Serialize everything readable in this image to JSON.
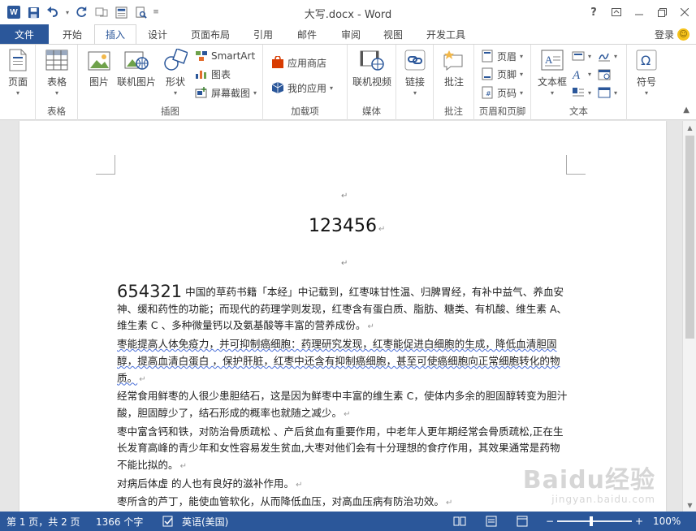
{
  "titlebar": {
    "doc_title": "大写.docx - Word",
    "help": "?",
    "app_logo": "W"
  },
  "tabs": {
    "file": "文件",
    "items": [
      "开始",
      "插入",
      "设计",
      "页面布局",
      "引用",
      "邮件",
      "审阅",
      "视图",
      "开发工具"
    ],
    "active": "插入",
    "login": "登录"
  },
  "ribbon": {
    "pages": {
      "btn": "页面",
      "group": ""
    },
    "table": {
      "btn": "表格",
      "group": "表格"
    },
    "illustrations": {
      "picture": "图片",
      "online_picture": "联机图片",
      "shapes": "形状",
      "smartart": "SmartArt",
      "chart": "图表",
      "screenshot": "屏幕截图",
      "group": "插图"
    },
    "addins": {
      "store": "应用商店",
      "my_apps": "我的应用",
      "group": "加载项"
    },
    "media": {
      "online_video": "联机视频",
      "group": "媒体"
    },
    "links": {
      "link": "链接",
      "group": ""
    },
    "comments": {
      "comment": "批注",
      "group": "批注"
    },
    "header_footer": {
      "header": "页眉",
      "footer": "页脚",
      "page_number": "页码",
      "group": "页眉和页脚"
    },
    "text": {
      "textbox": "文本框",
      "group": "文本"
    },
    "symbols": {
      "symbol": "符号",
      "group": ""
    }
  },
  "document": {
    "heading": "123456",
    "lead_number": "654321",
    "paragraphs": [
      "中国的草药书籍「本经」中记载到，红枣味甘性温、归脾胃经，有补中益气、养血安神、缓和药性的功能；而现代的药理学则发现，红枣含有蛋白质、脂肪、糖类、有机酸、维生素 A、维生素 C 、多种微量钙以及氨基酸等丰富的营养成份。",
      "枣能提高人体免疫力，并可抑制癌细胞：药理研究发现，红枣能促进白细胞的生成，降低血清胆固醇，提高血清白蛋白 ，保护肝脏，红枣中还含有抑制癌细胞，甚至可使癌细胞向正常细胞转化的物质。",
      "经常食用鲜枣的人很少患胆结石，这是因为鲜枣中丰富的维生素 C，使体内多余的胆固醇转变为胆汁酸，胆固醇少了，结石形成的概率也就随之减少。",
      "枣中富含钙和铁，对防治骨质疏松 、产后贫血有重要作用，中老年人更年期经常会骨质疏松,正在生长发育高峰的青少年和女性容易发生贫血,大枣对他们会有十分理想的食疗作用，其效果通常是药物不能比拟的。",
      "对病后体虚 的人也有良好的滋补作用。",
      "枣所含的芦丁，能使血管软化，从而降低血压，对高血压病有防治功效。"
    ]
  },
  "statusbar": {
    "page": "第 1 页，共 2 页",
    "words": "1366 个字",
    "language": "英语(美国)",
    "zoom": "100%",
    "zoom_minus": "−",
    "zoom_plus": "+"
  },
  "watermark": {
    "main": "Baidu经验",
    "sub": "jingyan.baidu.com"
  },
  "colors": {
    "accent": "#2b579a",
    "ribbon_bg": "#ffffff",
    "page_bg": "#ffffff",
    "canvas_bg": "#e6e6e6"
  }
}
